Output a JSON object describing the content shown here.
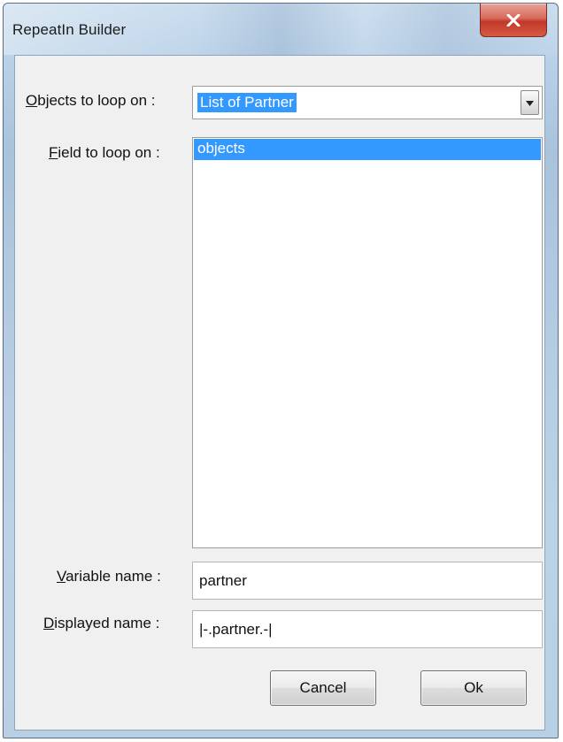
{
  "window": {
    "title": "RepeatIn Builder",
    "close_icon": "close-icon"
  },
  "objects_to_loop": {
    "label_first": "O",
    "label_rest": "bjects to loop on :",
    "value": "List of Partner",
    "dropdown_icon": "chevron-down-icon"
  },
  "field_to_loop": {
    "label_first": "F",
    "label_rest": "ield to loop on :",
    "items": [
      {
        "label": "objects",
        "selected": true
      }
    ]
  },
  "variable_name": {
    "label_first": "V",
    "label_rest": "ariable name :",
    "value": "partner"
  },
  "displayed_name": {
    "label_first": "D",
    "label_rest": "isplayed name :",
    "value": "|-.partner.-|"
  },
  "buttons": {
    "cancel_first": "C",
    "cancel_rest": "ancel",
    "ok_first": "O",
    "ok_mid": "k",
    "ok_rest": ""
  },
  "colors": {
    "selection": "#3399ff",
    "close_button": "#c2382a",
    "dialog_background": "#f0f0f0"
  }
}
